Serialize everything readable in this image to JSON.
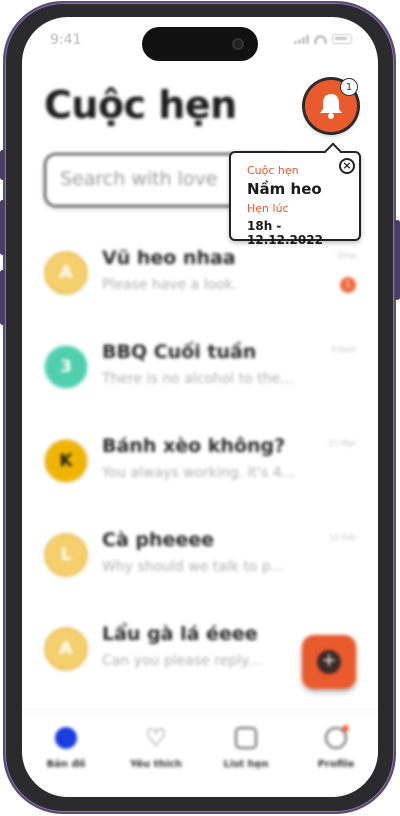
{
  "status_bar": {
    "time": "9:41"
  },
  "header": {
    "title": "Cuộc hẹn",
    "notification_count": "1"
  },
  "search": {
    "placeholder": "Search with love"
  },
  "conversations": [
    {
      "initial": "A",
      "avatar_color": "#f4cf6c",
      "title": "Vũ heo nhaa",
      "preview": "Please have a look.",
      "time": "Urne",
      "unread": "1"
    },
    {
      "initial": "3",
      "avatar_color": "#4fcfae",
      "title": "BBQ Cuối tuần",
      "preview": "There is no alcohol to the...",
      "time": "3:0am",
      "unread": ""
    },
    {
      "initial": "K",
      "avatar_color": "#f0b400",
      "title": "Bánh xèo không?",
      "preview": "You always working. It's 4...",
      "time": "27 Mar",
      "unread": ""
    },
    {
      "initial": "L",
      "avatar_color": "#f4cf6c",
      "title": "Cà pheeee",
      "preview": "Why should we talk to p...",
      "time": "12 Feb",
      "unread": ""
    },
    {
      "initial": "A",
      "avatar_color": "#f4cf6c",
      "title": "Lẩu gà lá éeee",
      "preview": "Can you please reply...",
      "time": "",
      "unread": ""
    }
  ],
  "popup": {
    "label1": "Cuộc hẹn",
    "value1": "Nầm heo",
    "label2": "Hẹn lúc",
    "value2": "18h - 12.12.2022"
  },
  "tabs": [
    {
      "label": "Bản đồ",
      "icon": "map-icon"
    },
    {
      "label": "Yêu thích",
      "icon": "heart-icon"
    },
    {
      "label": "List hẹn",
      "icon": "list-icon"
    },
    {
      "label": "Profile",
      "icon": "profile-icon"
    }
  ],
  "colors": {
    "accent": "#e95a2d",
    "active_tab": "#1a3de0"
  }
}
